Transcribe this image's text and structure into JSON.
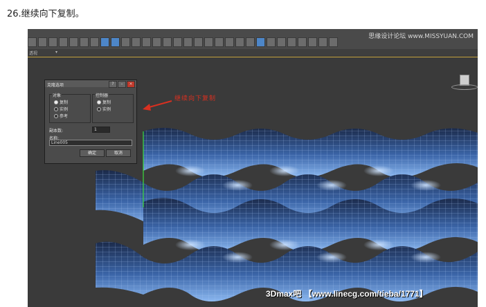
{
  "step_caption": "26.继续向下复制。",
  "toolbar_watermark": "思缘设计论坛  www.MISSYUAN.COM",
  "subbar": {
    "label": "透视",
    "dropdown": "▾"
  },
  "clone_dialog": {
    "title": "克隆选项",
    "title_buttons": [
      "?",
      "–",
      "×"
    ],
    "object_group": {
      "title": "对象",
      "options": [
        "复制",
        "实例",
        "参考"
      ],
      "selected": 0
    },
    "controller_group": {
      "title": "控制器",
      "options": [
        "复制",
        "实例"
      ],
      "selected": 0
    },
    "copies_label": "副本数:",
    "copies_value": "1",
    "name_label": "名称:",
    "name_value": "Line005",
    "ok_label": "确定",
    "cancel_label": "取消"
  },
  "annotation": "继续向下复制",
  "bottom_watermark": "3Dmax吧 【www.linecg.com/tieba/1771】",
  "colors": {
    "viewport_bg": "#3a3a3a",
    "wave_blue": "#5b8fd6",
    "annotation_red": "#d83020"
  },
  "icons": [
    "toolbar-icon",
    "view-cube-icon",
    "arrow-icon"
  ]
}
